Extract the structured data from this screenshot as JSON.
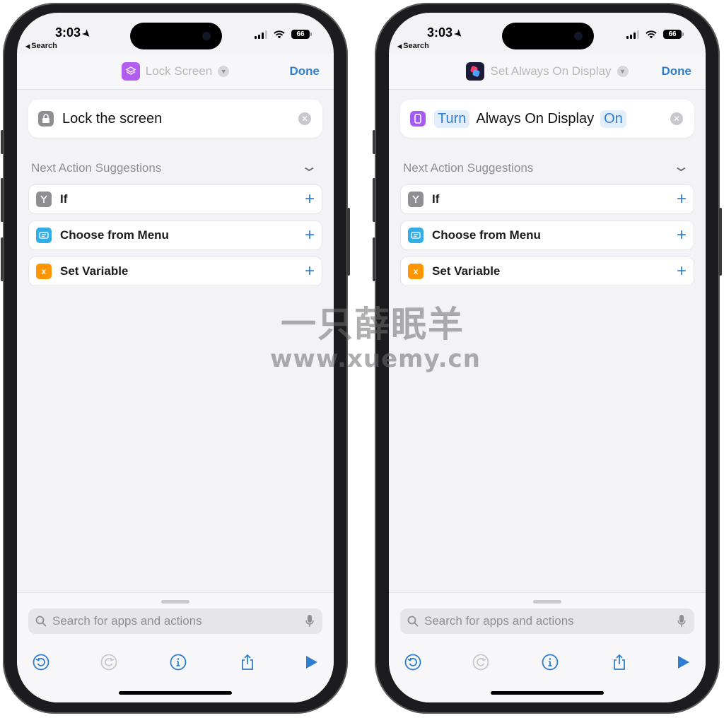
{
  "phones": [
    {
      "status": {
        "time": "3:03",
        "back": "Search",
        "battery": "66"
      },
      "header": {
        "title": "Lock Screen",
        "done": "Done",
        "icon": "layers-icon",
        "icon_color": "#b35cf0"
      },
      "action": {
        "text": "Lock the screen",
        "icon": "lock-icon",
        "icon_color": "#8e8e93"
      },
      "suggestions": {
        "header": "Next Action Suggestions",
        "items": [
          {
            "label": "If",
            "icon": "branch-icon",
            "color": "#8e8e93"
          },
          {
            "label": "Choose from Menu",
            "icon": "menu-icon",
            "color": "#32ade6"
          },
          {
            "label": "Set Variable",
            "icon": "variable-icon",
            "color": "#ff9500"
          }
        ]
      },
      "search": {
        "placeholder": "Search for apps and actions"
      }
    },
    {
      "status": {
        "time": "3:03",
        "back": "Search",
        "battery": "66"
      },
      "header": {
        "title": "Set Always On Display",
        "done": "Done",
        "icon": "shortcuts-icon",
        "icon_color": "#1c1c3a"
      },
      "action": {
        "token_before": "Turn",
        "text": "Always On Display",
        "token_after": "On",
        "icon": "phone-icon",
        "icon_color": "#a25cf0"
      },
      "suggestions": {
        "header": "Next Action Suggestions",
        "items": [
          {
            "label": "If",
            "icon": "branch-icon",
            "color": "#8e8e93"
          },
          {
            "label": "Choose from Menu",
            "icon": "menu-icon",
            "color": "#32ade6"
          },
          {
            "label": "Set Variable",
            "icon": "variable-icon",
            "color": "#ff9500"
          }
        ]
      },
      "search": {
        "placeholder": "Search for apps and actions"
      }
    }
  ],
  "watermark": {
    "line1": "一只薛眠羊",
    "line2": "www.xuemy.cn"
  },
  "colors": {
    "accent": "#2f7fd0",
    "background": "#f2f2f7"
  }
}
